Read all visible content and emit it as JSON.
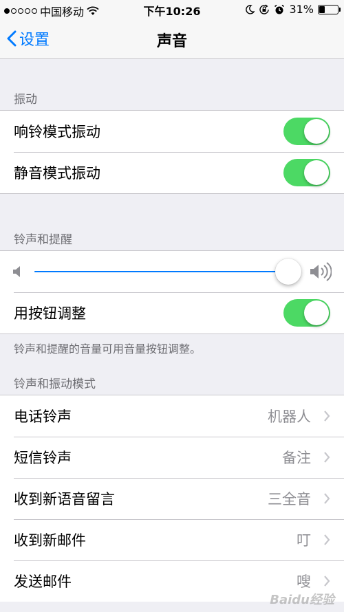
{
  "status_bar": {
    "carrier": "中国移动",
    "time": "下午10:26",
    "battery_percent": "31%",
    "battery_level": 0.31,
    "signal_bars_filled": 1,
    "signal_bars_total": 5,
    "icons": [
      "wifi-icon",
      "moon-icon",
      "orientation-lock-icon",
      "alarm-icon",
      "battery-icon"
    ]
  },
  "nav": {
    "back_label": "设置",
    "title": "声音"
  },
  "vibrate_section": {
    "header": "振动",
    "items": [
      {
        "label": "响铃模式振动",
        "on": true
      },
      {
        "label": "静音模式振动",
        "on": true
      }
    ]
  },
  "ringer_section": {
    "header": "铃声和提醒",
    "volume_level": 0.96,
    "button_adjust": {
      "label": "用按钮调整",
      "on": true
    },
    "footnote": "铃声和提醒的音量可用音量按钮调整。"
  },
  "patterns_section": {
    "header": "铃声和振动模式",
    "items": [
      {
        "label": "电话铃声",
        "value": "机器人"
      },
      {
        "label": "短信铃声",
        "value": "备注"
      },
      {
        "label": "收到新语音留言",
        "value": "三全音"
      },
      {
        "label": "收到新邮件",
        "value": "叮"
      },
      {
        "label": "发送邮件",
        "value": "嗖"
      }
    ]
  },
  "watermark": "Baidu经验",
  "colors": {
    "accent": "#007aff",
    "toggle_on": "#4cd964",
    "background": "#efeff4"
  }
}
